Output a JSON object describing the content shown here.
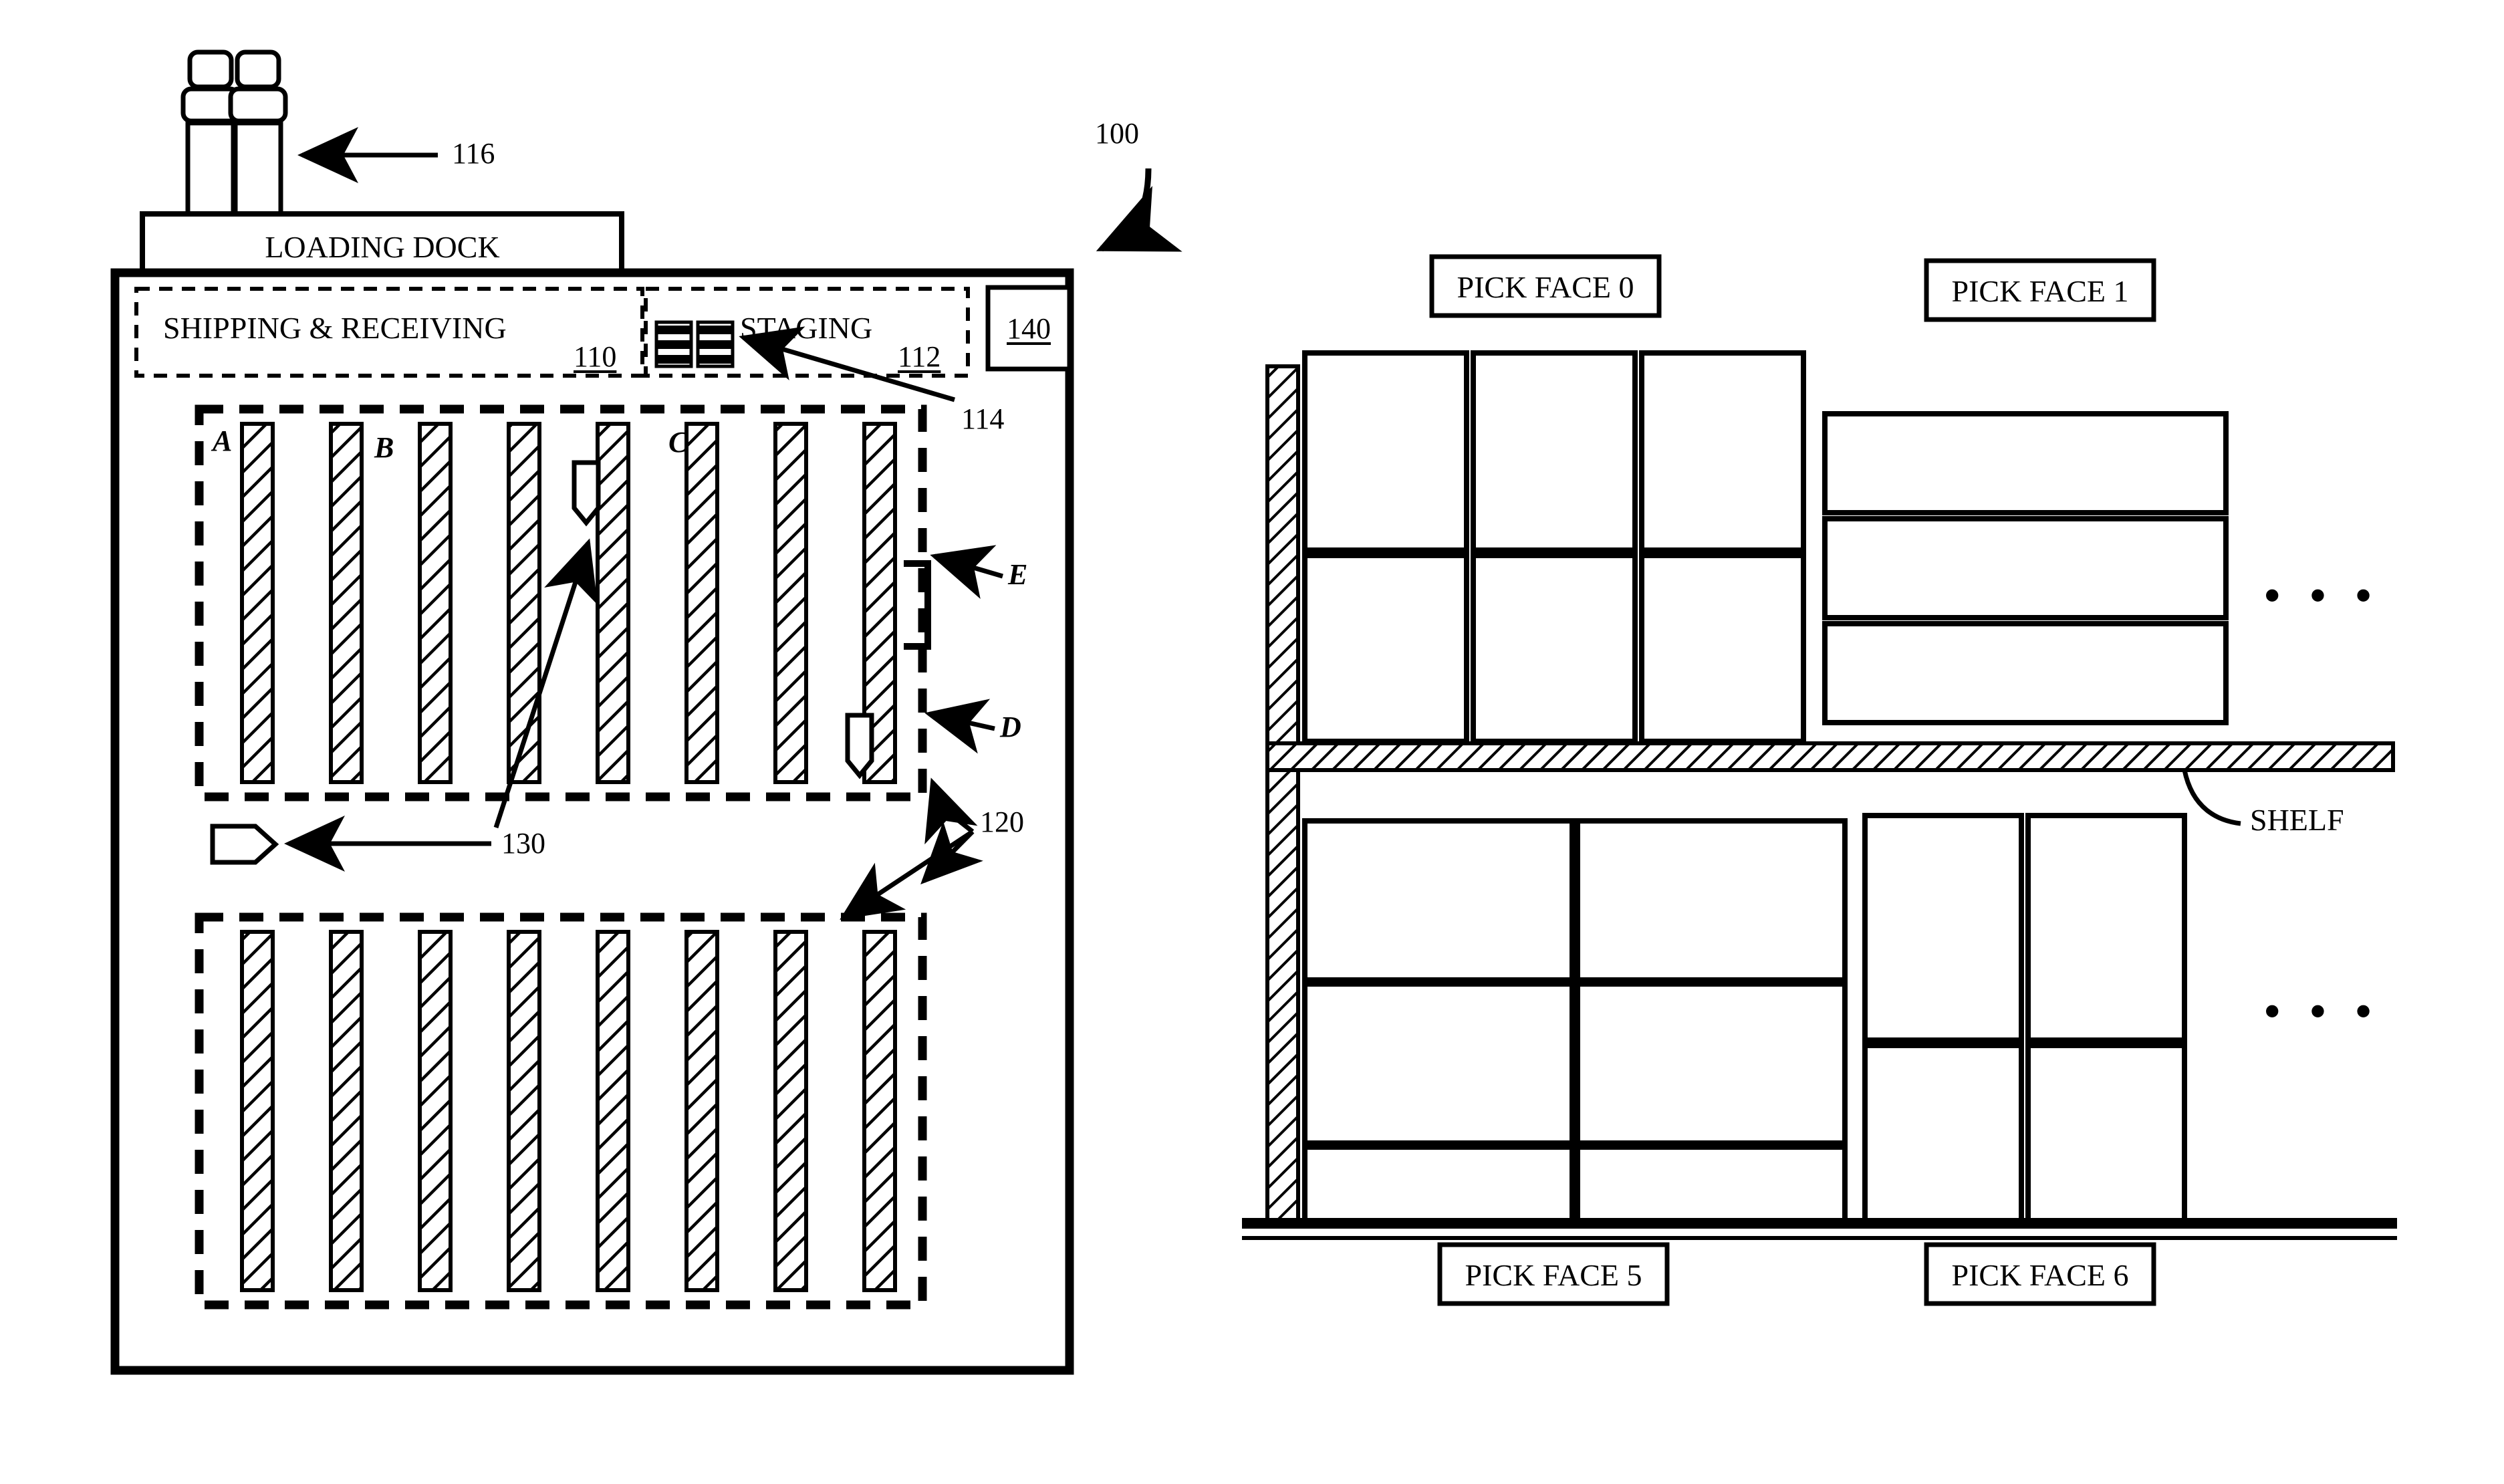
{
  "figure": {
    "figure_ref": "100",
    "domain": "warehouse-facility-layout-patent-figure"
  },
  "left_diagram": {
    "trucks_ref": "116",
    "loading_dock_label": "LOADING DOCK",
    "shipping_receiving_label": "SHIPPING & RECEIVING",
    "shipping_receiving_ref": "110",
    "staging_label": "STAGING",
    "staging_ref": "112",
    "staging_pallets_ref": "114",
    "control_box_ref": "140",
    "zone_ref": "120",
    "vehicle_ref": "130",
    "aisle_labels": {
      "a": "A",
      "b": "B",
      "c": "C",
      "d": "D",
      "e": "E"
    },
    "rack_count_top": 8,
    "rack_count_bottom": 8,
    "truck_count": 2,
    "vehicle_markers": 3
  },
  "right_diagram": {
    "shelf_label": "SHELF",
    "ellipsis": "• • •",
    "pick_faces": [
      {
        "id": "pf0",
        "label": "PICK FACE 0",
        "position": "upper-left",
        "rows": 2,
        "cols": 3,
        "item_shape": "tall"
      },
      {
        "id": "pf1",
        "label": "PICK FACE 1",
        "position": "upper-right",
        "rows": 3,
        "cols": 1,
        "item_shape": "wide"
      },
      {
        "id": "pf5",
        "label": "PICK FACE 5",
        "position": "lower-left",
        "rows": 3,
        "cols": 2,
        "item_shape": "wide"
      },
      {
        "id": "pf6",
        "label": "PICK FACE 6",
        "position": "lower-right",
        "rows": 2,
        "cols": 2,
        "item_shape": "tall"
      }
    ]
  },
  "colors": {
    "line": "#000000",
    "background": "#ffffff",
    "hatch": "#000000"
  }
}
